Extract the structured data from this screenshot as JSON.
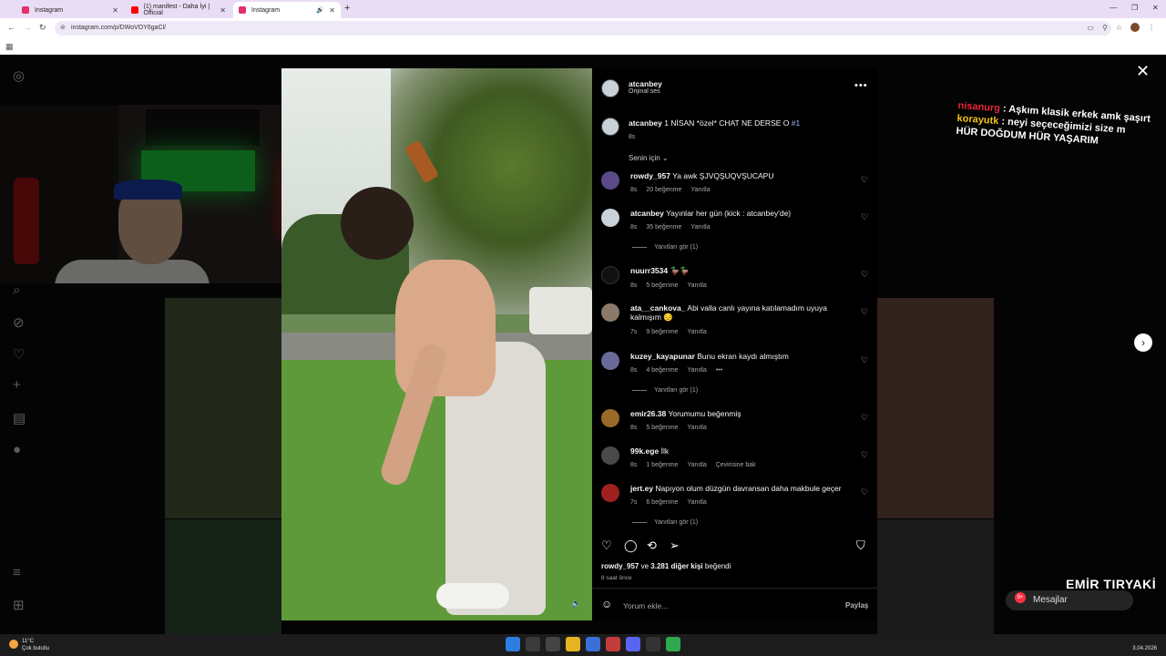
{
  "browser": {
    "tabs": [
      {
        "title": "Instagram",
        "color": "#e1306c"
      },
      {
        "title": "(1) manifest - Daha İyi | Official",
        "color": "#ff0000"
      },
      {
        "title": "Instagram",
        "color": "#e1306c"
      }
    ],
    "url": "instagram.com/p/DWoVOY6gaCl/"
  },
  "post": {
    "author": "atcanbey",
    "audio": "Orijinal ses",
    "caption_user": "atcanbey",
    "caption_text": "1 NİSAN *özel* CHAT NE DERSE O",
    "caption_hashtag": "#1",
    "caption_time": "8s",
    "for_you": "Senin için",
    "likes_user": "rowdy_957",
    "likes_mid": "ve",
    "likes_rest": "3.281 diğer kişi",
    "likes_end": "beğendi",
    "posted_ago": "8 saat önce",
    "comment_placeholder": "Yorum ekle...",
    "post_label": "Paylaş"
  },
  "comments": [
    {
      "user": "rowdy_957",
      "text": "Ya awk ŞJVQŞUQVŞUCAPU",
      "time": "8s",
      "likes": "20 beğenme",
      "reply": "Yanıtla",
      "extra": "",
      "avatar": "#5a4a8a",
      "replies": ""
    },
    {
      "user": "atcanbey",
      "text": "Yayınlar her gün (kick : atcanbey'de)",
      "time": "8s",
      "likes": "35 beğenme",
      "reply": "Yanıtla",
      "extra": "",
      "avatar": "#c9d2d8",
      "replies": "Yanıtları gör (1)"
    },
    {
      "user": "nuurr3534",
      "text": "🦆🦆",
      "time": "8s",
      "likes": "5 beğenme",
      "reply": "Yanıtla",
      "extra": "",
      "avatar": "#111111",
      "replies": ""
    },
    {
      "user": "ata__cankova_",
      "text": "Abi valla canlı yayına katılamadım uyuya kalmışım 😔",
      "time": "7s",
      "likes": "9 beğenme",
      "reply": "Yanıtla",
      "extra": "",
      "avatar": "#8a7a6a",
      "replies": ""
    },
    {
      "user": "kuzey_kayapunar",
      "text": "Bunu ekran kaydı almıştım",
      "time": "8s",
      "likes": "4 beğenme",
      "reply": "Yanıtla",
      "extra": "•••",
      "avatar": "#6a6a9a",
      "replies": "Yanıtları gör (1)"
    },
    {
      "user": "emir26.38",
      "text": "Yorumumu beğenmiş",
      "time": "8s",
      "likes": "5 beğenme",
      "reply": "Yanıtla",
      "extra": "",
      "avatar": "#9a6a2a",
      "replies": ""
    },
    {
      "user": "99k.ege",
      "text": "İlk",
      "time": "8s",
      "likes": "1 beğenme",
      "reply": "Yanıtla",
      "extra": "Çevirisine bak",
      "avatar": "#4a4a4a",
      "replies": ""
    },
    {
      "user": "jert.ey",
      "text": "Napıyon olum düzgün davransan daha makbule geçer",
      "time": "7s",
      "likes": "6 beğenme",
      "reply": "Yanıtla",
      "extra": "",
      "avatar": "#a02020",
      "replies": "Yanıtları gör (1)"
    }
  ],
  "chat": [
    {
      "user": "nisanurg",
      "text": ": Aşkım klasik erkek amk şaşırt"
    },
    {
      "user": "korayutk",
      "text": ": neyi seçeceğimizi size m"
    },
    {
      "user": "",
      "text": "HÜR DOĞDUM HÜR YAŞARIM"
    }
  ],
  "messages": {
    "label": "Mesajlar",
    "badge": "9+"
  },
  "watermark": "EMİR TIRYAKİ",
  "taskbar": {
    "temp": "11°C",
    "weather": "Çok bulutlu",
    "date": "3.04.2026"
  }
}
